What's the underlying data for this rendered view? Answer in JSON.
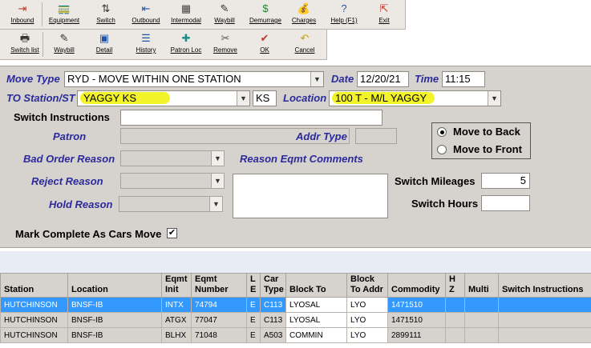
{
  "toolbar1": [
    {
      "label": "Inbound",
      "icon": "⇥",
      "name": "inbound-button",
      "color": "#c0392b"
    },
    {
      "label": "Equipment",
      "icon": "🚃",
      "name": "equipment-button",
      "color": "#7a4a1a"
    },
    {
      "label": "Switch",
      "icon": "⇅",
      "name": "switch-button",
      "color": "#333333"
    },
    {
      "label": "Outbound",
      "icon": "⇤",
      "name": "outbound-button",
      "color": "#2255aa"
    },
    {
      "label": "Intermodal",
      "icon": "▦",
      "name": "intermodal-button",
      "color": "#444444"
    },
    {
      "label": "Waybill",
      "icon": "✎",
      "name": "waybill-button",
      "color": "#333333"
    },
    {
      "label": "Demurrage",
      "icon": "$",
      "name": "demurrage-button",
      "color": "#1a8a2a"
    },
    {
      "label": "Charges",
      "icon": "💰",
      "name": "charges-button",
      "color": "#1a8a2a"
    },
    {
      "label": "Help (F1)",
      "icon": "?",
      "name": "help-button",
      "color": "#2255aa"
    },
    {
      "label": "Exit",
      "icon": "⇱",
      "name": "exit-button",
      "color": "#c0392b"
    }
  ],
  "toolbar2": [
    {
      "label": "Switch list",
      "icon": "🖶",
      "name": "switch-list-button",
      "color": "#333333"
    },
    {
      "label": "Waybill",
      "icon": "✎",
      "name": "waybill2-button",
      "color": "#333333"
    },
    {
      "label": "Detail",
      "icon": "▣",
      "name": "detail-button",
      "color": "#2255aa"
    },
    {
      "label": "History",
      "icon": "☰",
      "name": "history-button",
      "color": "#2255aa"
    },
    {
      "label": "Patron Loc",
      "icon": "✚",
      "name": "patron-loc-button",
      "color": "#1a8a8a"
    },
    {
      "label": "Remove",
      "icon": "✂",
      "name": "remove-button",
      "color": "#555555"
    },
    {
      "label": "OK",
      "icon": "✔",
      "name": "ok-button",
      "color": "#c0392b"
    },
    {
      "label": "Cancel",
      "icon": "↶",
      "name": "cancel-button",
      "color": "#c8a000"
    }
  ],
  "form": {
    "move_type_label": "Move Type",
    "move_type_value": "RYD - MOVE WITHIN ONE STATION",
    "date_label": "Date",
    "date_value": "12/20/21",
    "time_label": "Time",
    "time_value": "11:15",
    "to_station_label": "TO Station/ST",
    "to_station_value": "YAGGY KS",
    "state_value": "KS",
    "location_label": "Location",
    "location_value": "100 T - M/L YAGGY",
    "switch_instructions_label": "Switch Instructions",
    "switch_instructions_value": "",
    "patron_label": "Patron",
    "addr_type_label": "Addr Type",
    "bad_order_label": "Bad Order Reason",
    "reason_eqmt_label": "Reason Eqmt Comments",
    "reject_label": "Reject Reason",
    "hold_label": "Hold Reason",
    "move_to_back_label": "Move to Back",
    "move_to_front_label": "Move to Front",
    "move_to_back_selected": true,
    "switch_mileages_label": "Switch Mileages",
    "switch_mileages_value": "5",
    "switch_hours_label": "Switch Hours",
    "switch_hours_value": "",
    "mark_complete_label": "Mark Complete As Cars Move",
    "mark_complete_checked": true
  },
  "grid": {
    "headers": [
      "Station",
      "Location",
      "Eqmt Init",
      "Eqmt Number",
      "L E",
      "Car Type",
      "Block To",
      "Block To Addr",
      "Commodity",
      "H Z",
      "Multi",
      "Switch Instructions"
    ],
    "rows": [
      [
        "HUTCHINSON",
        "BNSF-IB",
        "INTX",
        "74794",
        "E",
        "C113",
        "LYOSAL",
        "LYO",
        "1471510",
        "",
        "",
        ""
      ],
      [
        "HUTCHINSON",
        "BNSF-IB",
        "ATGX",
        "77047",
        "E",
        "C113",
        "LYOSAL",
        "LYO",
        "1471510",
        "",
        "",
        ""
      ],
      [
        "HUTCHINSON",
        "BNSF-IB",
        "BLHX",
        "71048",
        "E",
        "A503",
        "COMMIN",
        "LYO",
        "2899111",
        "",
        "",
        ""
      ]
    ],
    "selected_row": 0
  },
  "colors": {
    "highlight": "#f3f32a",
    "selected_row": "#3399ff",
    "label_blue": "#2a2a9c"
  }
}
